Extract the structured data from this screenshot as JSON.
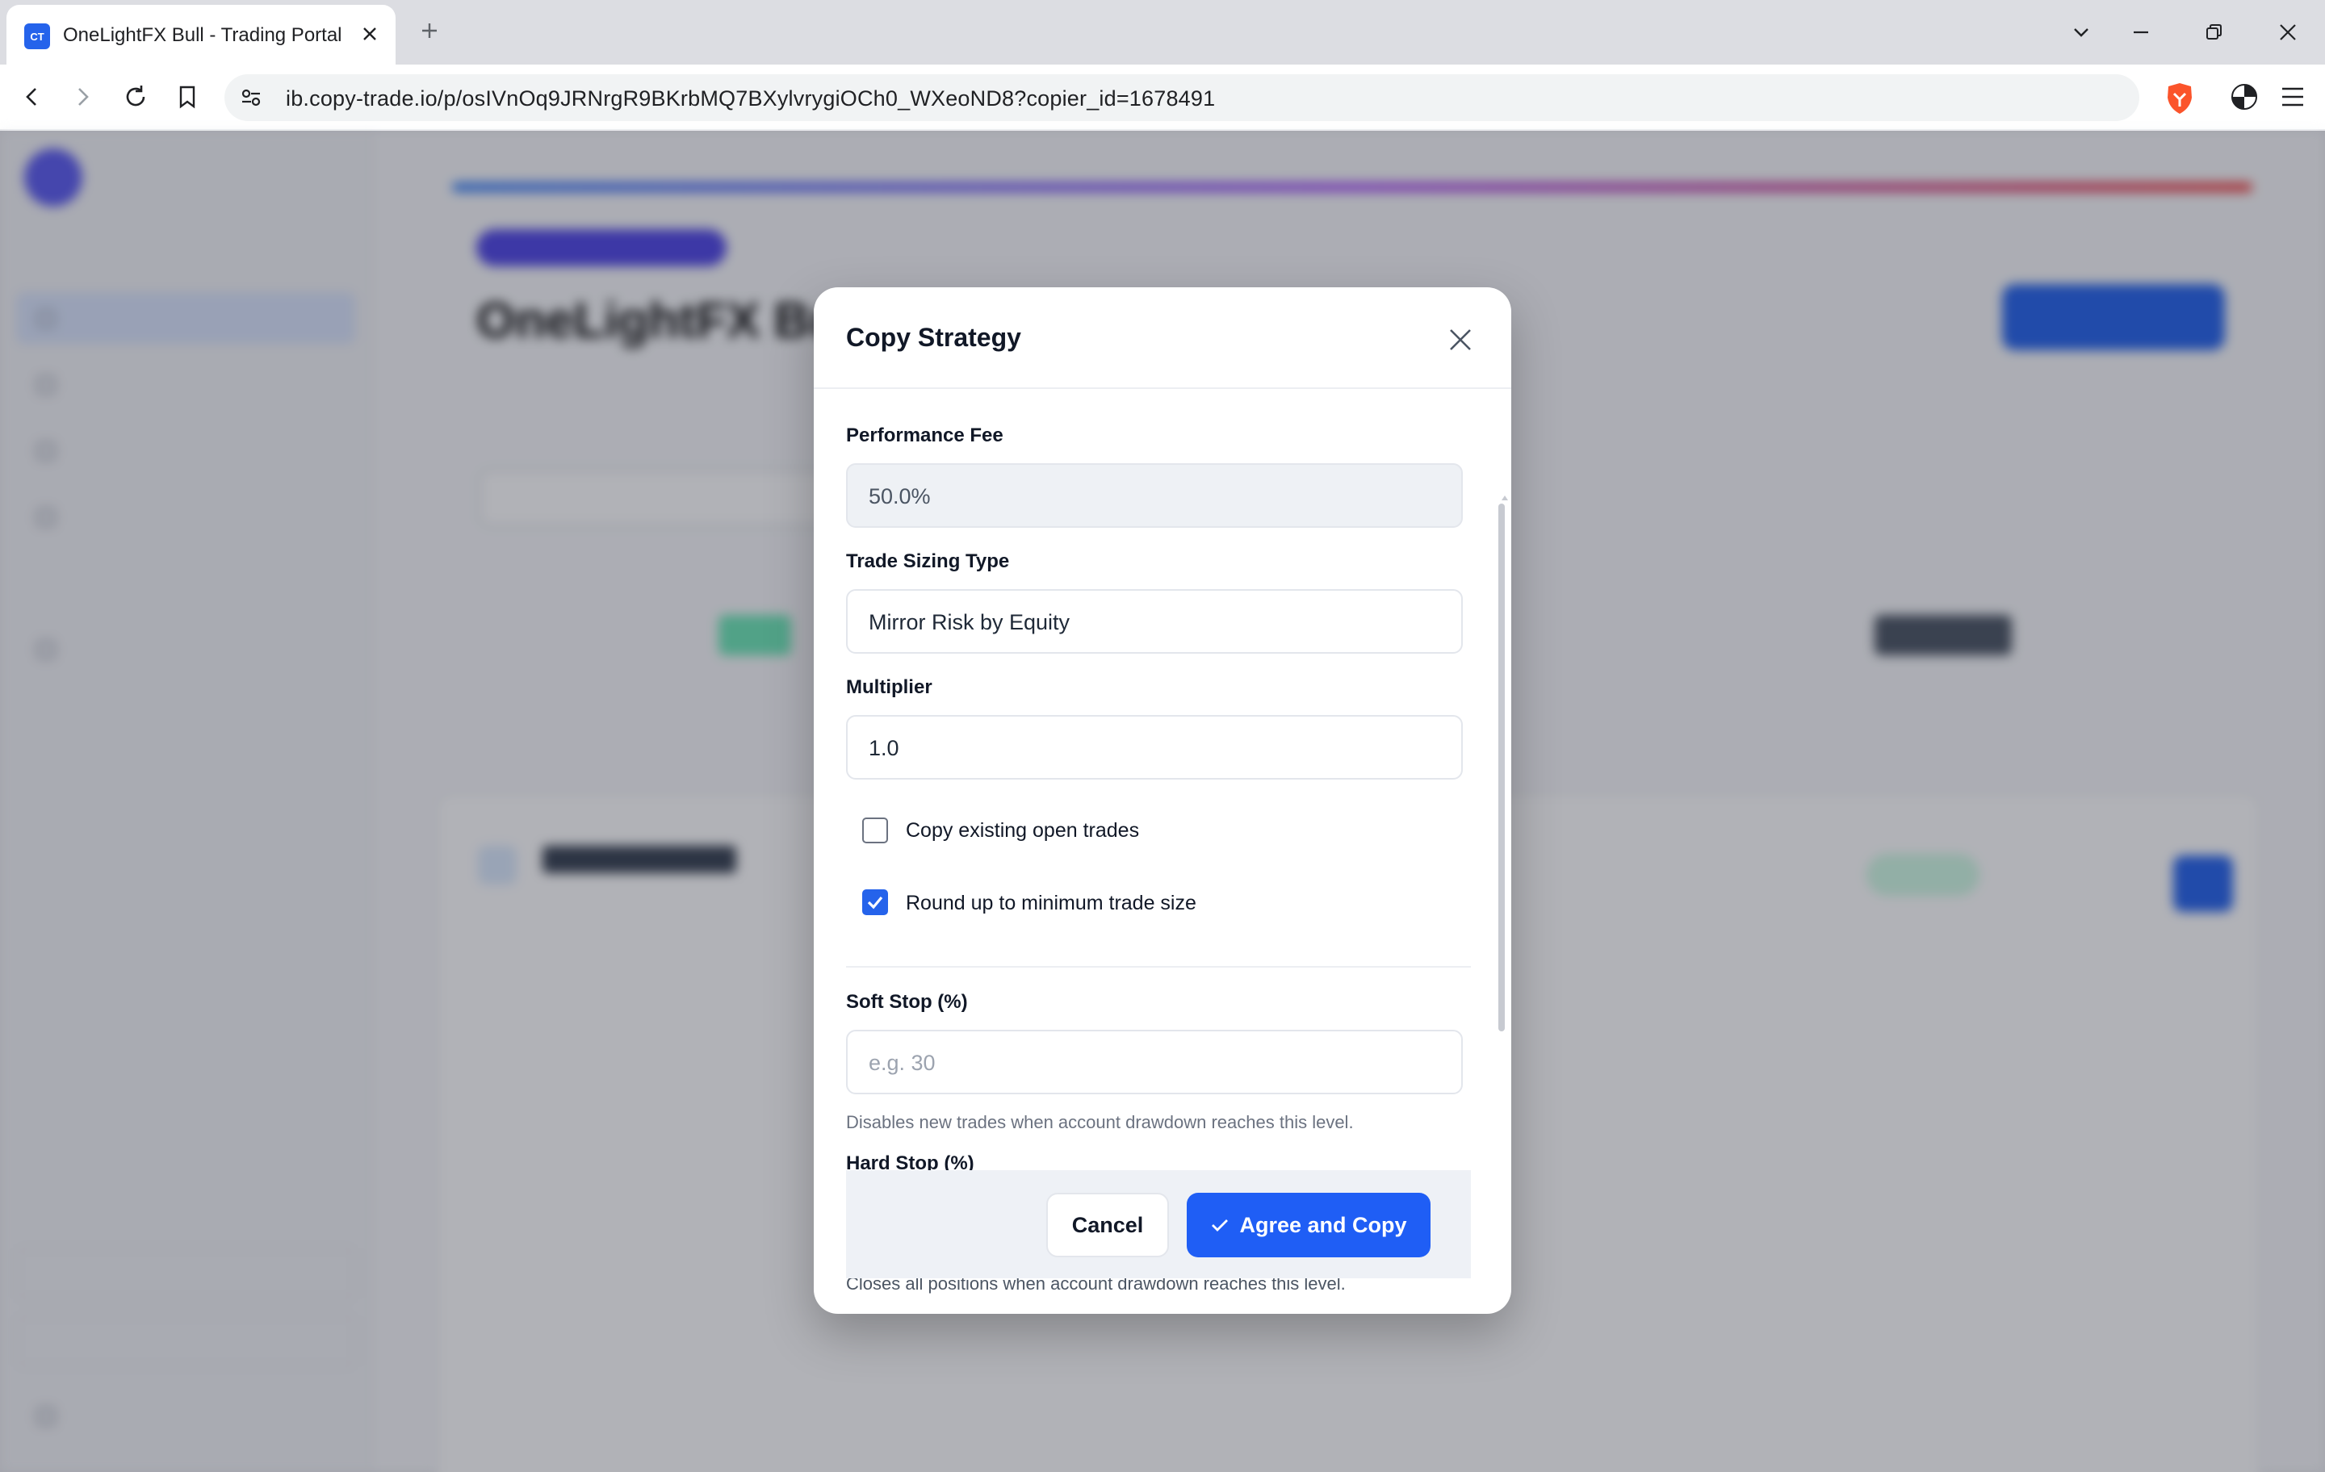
{
  "browser": {
    "tab_title": "OneLightFX Bull - Trading Portal",
    "favicon_text": "CT",
    "url": "ib.copy-trade.io/p/osIVnOq9JRNrgR9BKrbMQ7BXylvrygiOCh0_WXeoND8?copier_id=1678491",
    "accent": "#2563eb"
  },
  "background_page": {
    "title": "OneLightFX Bull"
  },
  "modal": {
    "title": "Copy Strategy",
    "fields": {
      "performance_fee": {
        "label": "Performance Fee",
        "value": "50.0%"
      },
      "trade_sizing_type": {
        "label": "Trade Sizing Type",
        "value": "Mirror Risk by Equity"
      },
      "multiplier": {
        "label": "Multiplier",
        "value": "1.0"
      },
      "soft_stop": {
        "label": "Soft Stop (%)",
        "placeholder": "e.g. 30",
        "help": "Disables new trades when account drawdown reaches this level."
      },
      "hard_stop": {
        "label": "Hard Stop (%)",
        "help": "Closes all positions when account drawdown reaches this level."
      }
    },
    "checkboxes": {
      "copy_existing": {
        "label": "Copy existing open trades",
        "checked": false
      },
      "round_up": {
        "label": "Round up to minimum trade size",
        "checked": true
      }
    },
    "buttons": {
      "cancel": "Cancel",
      "agree": "Agree and Copy"
    },
    "colors": {
      "primary": "#1f5ef5",
      "overlay": "rgba(25,30,45,0.34)"
    }
  }
}
